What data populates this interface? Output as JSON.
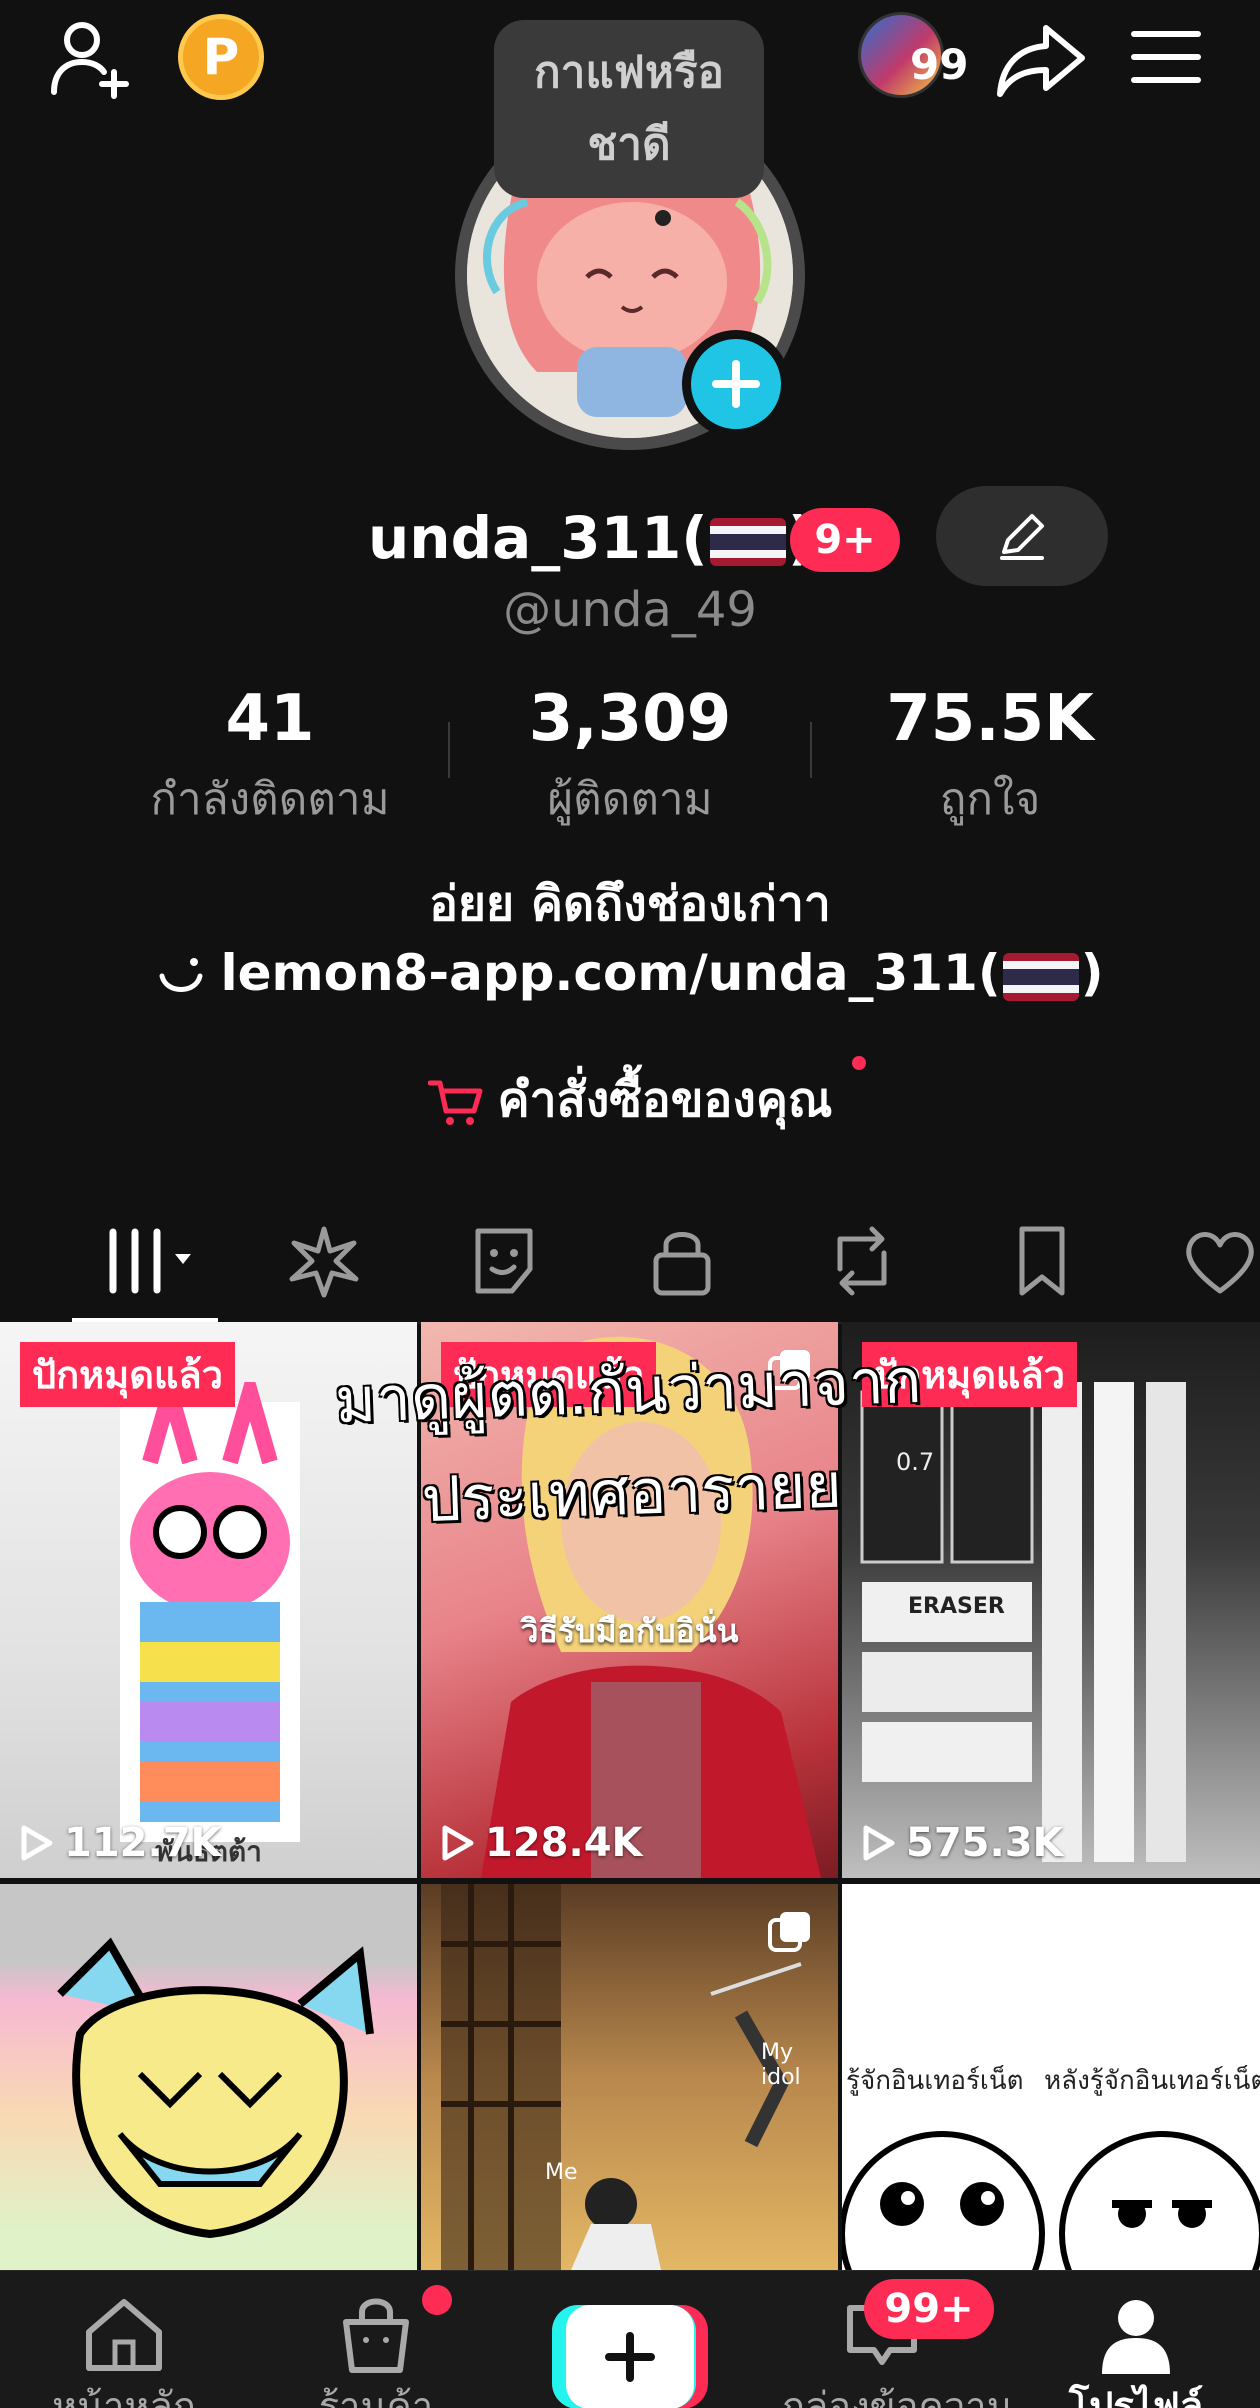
{
  "top_bar": {
    "add_friend_icon": "person-plus-icon",
    "coin_letter": "P",
    "story_count": "99",
    "share_icon": "share-arrow-icon",
    "menu_icon": "hamburger-menu-icon"
  },
  "profile": {
    "bubble_text": "กาแฟหรือชาดี",
    "display_name_prefix": "unda_311(",
    "display_name_suffix": ")",
    "name_badge": "9+",
    "handle": "@unda_49",
    "bio": "อ่ยย คิดถึงช่องเก่าา",
    "link": "lemon8-app.com/unda_311(",
    "link_suffix": ")",
    "orders_label": "คำสั่งซื้อของคุณ"
  },
  "stats": [
    {
      "value": "41",
      "label": "กำลังติดตาม"
    },
    {
      "value": "3,309",
      "label": "ผู้ติดตาม"
    },
    {
      "value": "75.5K",
      "label": "ถูกใจ"
    }
  ],
  "tabs": [
    {
      "icon": "grid-videos-icon"
    },
    {
      "icon": "sparkle-effects-icon"
    },
    {
      "icon": "sticker-icon"
    },
    {
      "icon": "lock-icon"
    },
    {
      "icon": "repost-icon"
    },
    {
      "icon": "bookmark-icon"
    },
    {
      "icon": "heart-icon"
    }
  ],
  "overlay_caption": "มาดูผู้ตต.กันว่ามาจากประเทศอารายย",
  "videos": [
    {
      "pinned": "ปักหมุดแล้ว",
      "views": "112.7K",
      "caption": "พันธ์ตต้า"
    },
    {
      "pinned": "ปักหมุดแล้ว",
      "views": "128.4K",
      "caption": "วิธีรับมือกับอินั่น"
    },
    {
      "pinned": "ปักหมุดแล้ว",
      "views": "575.3K",
      "eraser": "ERASER",
      "lead": "0.7"
    },
    {},
    {
      "label_top": "My idol",
      "label_bottom": "Me"
    },
    {
      "left_text": "รู้จักอินเทอร์เน็ต",
      "right_text": "หลังรู้จักอินเทอร์เน็ต"
    }
  ],
  "bottom_nav": {
    "home": "หน้าหลัก",
    "shop": "ร้านค้า",
    "inbox": "กล่องข้อความ",
    "inbox_badge": "99+",
    "profile": "โปรไฟล์"
  },
  "colors": {
    "background": "#111111",
    "accent_pink": "#fe2c55",
    "accent_cyan": "#25f4ee",
    "muted_text": "#9a9a9a"
  }
}
